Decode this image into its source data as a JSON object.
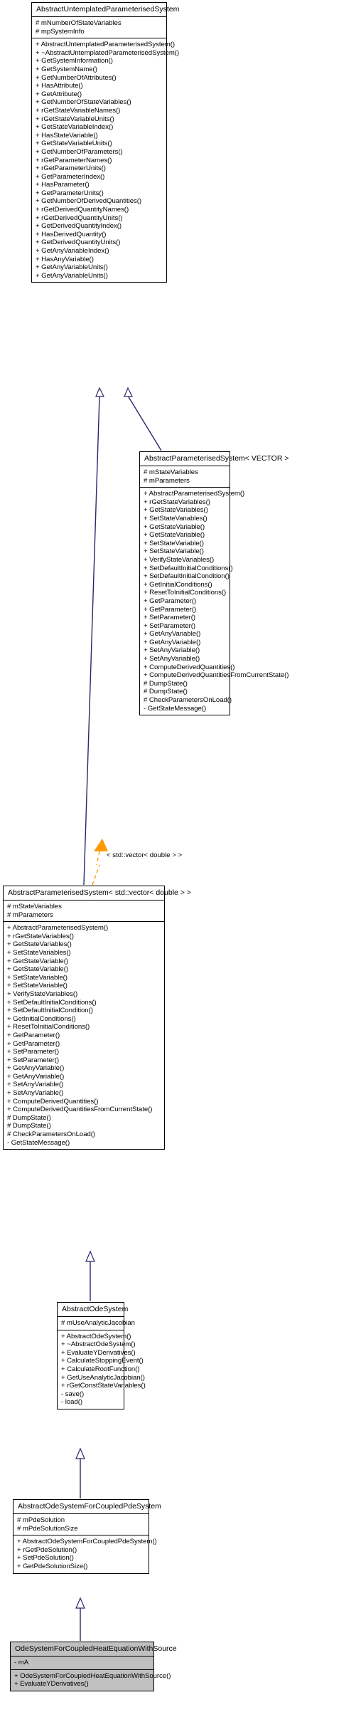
{
  "diagram": {
    "kind": "uml-class-inheritance-diagram",
    "edge_color_inheritance": "#27276b",
    "edge_color_instantiation": "#ff9900",
    "highlight_fill": "#c0c0c0",
    "box_fill": "#ffffff",
    "border_color": "#000000"
  },
  "classes": [
    {
      "id": "abstract-untemplated-parameterised-system",
      "name": "AbstractUntemplatedParameterisedSystem",
      "highlight": false,
      "attributes": [
        "# mNumberOfStateVariables",
        "# mpSystemInfo"
      ],
      "operations": [
        "+ AbstractUntemplatedParameterisedSystem()",
        "+ ~AbstractUntemplatedParameterisedSystem()",
        "+ GetSystemInformation()",
        "+ GetSystemName()",
        "+ GetNumberOfAttributes()",
        "+ HasAttribute()",
        "+ GetAttribute()",
        "+ GetNumberOfStateVariables()",
        "+ rGetStateVariableNames()",
        "+ rGetStateVariableUnits()",
        "+ GetStateVariableIndex()",
        "+ HasStateVariable()",
        "+ GetStateVariableUnits()",
        "+ GetNumberOfParameters()",
        "+ rGetParameterNames()",
        "+ rGetParameterUnits()",
        "+ GetParameterIndex()",
        "+ HasParameter()",
        "+ GetParameterUnits()",
        "+ GetNumberOfDerivedQuantities()",
        "+ rGetDerivedQuantityNames()",
        "+ rGetDerivedQuantityUnits()",
        "+ GetDerivedQuantityIndex()",
        "+ HasDerivedQuantity()",
        "+ GetDerivedQuantityUnits()",
        "+ GetAnyVariableIndex()",
        "+ HasAnyVariable()",
        "+ GetAnyVariableUnits()",
        "+ GetAnyVariableUnits()"
      ]
    },
    {
      "id": "abstract-parameterised-system-vector",
      "name": "AbstractParameterisedSystem< VECTOR >",
      "highlight": false,
      "attributes": [
        "# mStateVariables",
        "# mParameters"
      ],
      "operations": [
        "+ AbstractParameterisedSystem()",
        "+ rGetStateVariables()",
        "+ GetStateVariables()",
        "+ SetStateVariables()",
        "+ GetStateVariable()",
        "+ GetStateVariable()",
        "+ SetStateVariable()",
        "+ SetStateVariable()",
        "+ VerifyStateVariables()",
        "+ SetDefaultInitialConditions()",
        "+ SetDefaultInitialCondition()",
        "+ GetInitialConditions()",
        "+ ResetToInitialConditions()",
        "+ GetParameter()",
        "+ GetParameter()",
        "+ SetParameter()",
        "+ SetParameter()",
        "+ GetAnyVariable()",
        "+ GetAnyVariable()",
        "+ SetAnyVariable()",
        "+ SetAnyVariable()",
        "+ ComputeDerivedQuantities()",
        "+ ComputeDerivedQuantitiesFromCurrentState()",
        "# DumpState()",
        "# DumpState()",
        "# CheckParametersOnLoad()",
        "- GetStateMessage()"
      ]
    },
    {
      "id": "abstract-parameterised-system-stdvector-double",
      "name": "AbstractParameterisedSystem< std::vector< double > >",
      "highlight": false,
      "attributes": [
        "# mStateVariables",
        "# mParameters"
      ],
      "operations": [
        "+ AbstractParameterisedSystem()",
        "+ rGetStateVariables()",
        "+ GetStateVariables()",
        "+ SetStateVariables()",
        "+ GetStateVariable()",
        "+ GetStateVariable()",
        "+ SetStateVariable()",
        "+ SetStateVariable()",
        "+ VerifyStateVariables()",
        "+ SetDefaultInitialConditions()",
        "+ SetDefaultInitialCondition()",
        "+ GetInitialConditions()",
        "+ ResetToInitialConditions()",
        "+ GetParameter()",
        "+ GetParameter()",
        "+ SetParameter()",
        "+ SetParameter()",
        "+ GetAnyVariable()",
        "+ GetAnyVariable()",
        "+ SetAnyVariable()",
        "+ SetAnyVariable()",
        "+ ComputeDerivedQuantities()",
        "+ ComputeDerivedQuantitiesFromCurrentState()",
        "# DumpState()",
        "# DumpState()",
        "# CheckParametersOnLoad()",
        "- GetStateMessage()"
      ]
    },
    {
      "id": "abstract-ode-system",
      "name": "AbstractOdeSystem",
      "highlight": false,
      "attributes": [
        "# mUseAnalyticJacobian"
      ],
      "operations": [
        "+ AbstractOdeSystem()",
        "+ ~AbstractOdeSystem()",
        "+ EvaluateYDerivatives()",
        "+ CalculateStoppingEvent()",
        "+ CalculateRootFunction()",
        "+ GetUseAnalyticJacobian()",
        "+ rGetConstStateVariables()",
        "- save()",
        "- load()"
      ]
    },
    {
      "id": "abstract-ode-system-for-coupled-pde-system",
      "name": "AbstractOdeSystemForCoupledPdeSystem",
      "highlight": false,
      "attributes": [
        "# mPdeSolution",
        "# mPdeSolutionSize"
      ],
      "operations": [
        "+ AbstractOdeSystemForCoupledPdeSystem()",
        "+ rGetPdeSolution()",
        "+ SetPdeSolution()",
        "+ GetPdeSolutionSize()"
      ]
    },
    {
      "id": "ode-system-for-coupled-heat-equation-with-source",
      "name": "OdeSystemForCoupledHeatEquationWithSource",
      "highlight": true,
      "attributes": [
        "- mA"
      ],
      "operations": [
        "+ OdeSystemForCoupledHeatEquationWithSource()",
        "+ EvaluateYDerivatives()"
      ]
    }
  ],
  "edges": [
    {
      "id": "edge-vector-to-untemplated",
      "type": "inheritance",
      "from": "abstract-parameterised-system-vector",
      "to": "abstract-untemplated-parameterised-system"
    },
    {
      "id": "edge-stdvector-to-untemplated",
      "type": "inheritance",
      "from": "abstract-parameterised-system-stdvector-double",
      "to": "abstract-untemplated-parameterised-system"
    },
    {
      "id": "edge-stdvector-instantiates-vector",
      "type": "instantiation",
      "from": "abstract-parameterised-system-stdvector-double",
      "to": "abstract-parameterised-system-vector",
      "label": "< std::vector< double > >"
    },
    {
      "id": "edge-odesystem-to-stdvector",
      "type": "inheritance",
      "from": "abstract-ode-system",
      "to": "abstract-parameterised-system-stdvector-double"
    },
    {
      "id": "edge-coupledpde-to-odesystem",
      "type": "inheritance",
      "from": "abstract-ode-system-for-coupled-pde-system",
      "to": "abstract-ode-system"
    },
    {
      "id": "edge-heatequation-to-coupledpde",
      "type": "inheritance",
      "from": "ode-system-for-coupled-heat-equation-with-source",
      "to": "abstract-ode-system-for-coupled-pde-system"
    }
  ]
}
